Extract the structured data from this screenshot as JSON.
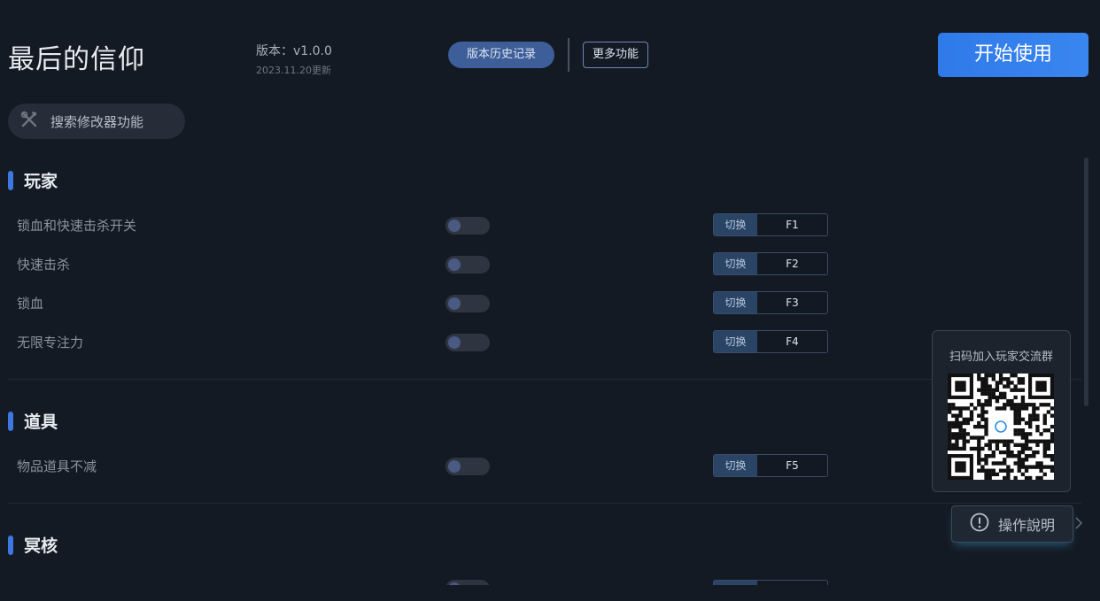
{
  "header": {
    "title": "最后的信仰",
    "version_label": "版本：v1.0.0",
    "version_date": "2023.11.20更新",
    "history_button": "版本历史记录",
    "more_button": "更多功能",
    "start_button": "开始使用"
  },
  "search": {
    "placeholder": "搜索修改器功能",
    "icon": "tools-icon"
  },
  "sections": [
    {
      "title": "玩家",
      "features": [
        {
          "label": "锁血和快速击杀开关",
          "enabled": false,
          "action": "切换",
          "key": "F1"
        },
        {
          "label": "快速击杀",
          "enabled": false,
          "action": "切换",
          "key": "F2"
        },
        {
          "label": "锁血",
          "enabled": false,
          "action": "切换",
          "key": "F3"
        },
        {
          "label": "无限专注力",
          "enabled": false,
          "action": "切换",
          "key": "F4"
        }
      ]
    },
    {
      "title": "道具",
      "features": [
        {
          "label": "物品道具不减",
          "enabled": false,
          "action": "切换",
          "key": "F5"
        }
      ]
    },
    {
      "title": "冥核",
      "features": []
    }
  ],
  "qr_panel": {
    "caption": "扫码加入玩家交流群"
  },
  "help": {
    "label": "操作說明",
    "icon": "exclamation-circle-icon"
  },
  "colors": {
    "background": "#141a24",
    "accent": "#3c78e0",
    "start_button": "#2f7ae9"
  }
}
